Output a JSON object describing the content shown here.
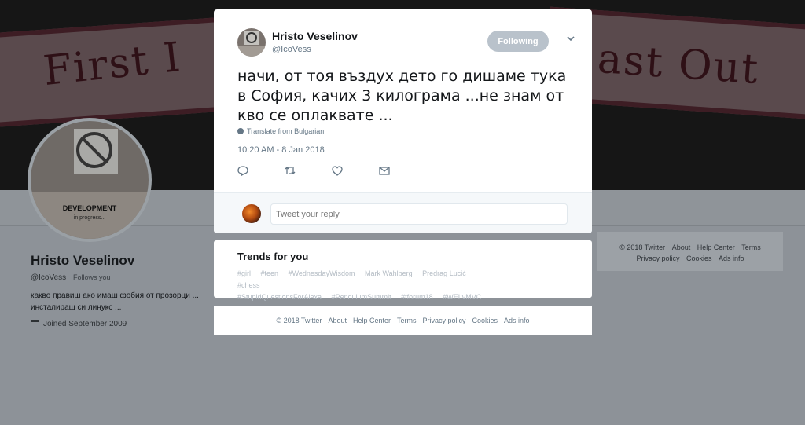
{
  "banner": {
    "left_text": "First I",
    "right_text": "ast Out"
  },
  "profile": {
    "avatar_line1": "DEVELOPMENT",
    "avatar_line2": "in progress...",
    "name": "Hristo Veselinov",
    "handle": "@IcoVess",
    "follows_you": "Follows you",
    "bio": "какво правиш ако имаш фобия от прозорци ... инсталираш си линукс ...",
    "joined": "Joined September 2009"
  },
  "tweet": {
    "author_name": "Hristo Veselinov",
    "author_handle": "@IcoVess",
    "follow_label": "Following",
    "text": "начи, от тоя въздух дето го дишаме тука в София, качих 3 килограма ...не знам от кво се оплаквате ...",
    "translate_label": "Translate from Bulgarian",
    "timestamp": "10:20 AM - 8 Jan 2018",
    "reply_placeholder": "Tweet your reply"
  },
  "trends": {
    "title": "Trends for you",
    "items": [
      "#girl",
      "#teen",
      "#WednesdayWisdom",
      "Mark Wahlberg",
      "Predrag Lucić",
      "#chess",
      "#StupidQuestionsForAlexa",
      "#PendulumSummit",
      "#tforum18",
      "#WELvMVC"
    ]
  },
  "footer": {
    "items": [
      "© 2018 Twitter",
      "About",
      "Help Center",
      "Terms",
      "Privacy policy",
      "Cookies",
      "Ads info"
    ]
  },
  "colors": {
    "follow_button_bg": "#b9c2cb",
    "overlay_bg": "#8d9298",
    "accent": "#1da1f2"
  },
  "icons": [
    "reply-icon",
    "retweet-icon",
    "like-icon",
    "message-icon",
    "caret-down-icon",
    "globe-icon",
    "calendar-icon"
  ]
}
